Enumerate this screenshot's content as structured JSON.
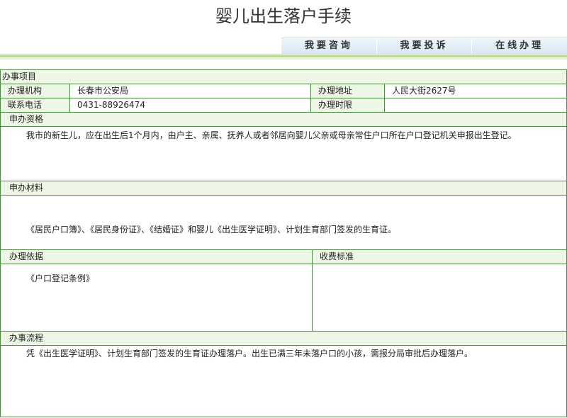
{
  "page": {
    "title": "婴儿出生落户手续"
  },
  "nav": {
    "items": [
      "我要咨询",
      "我要投诉",
      "在线办理"
    ]
  },
  "table": {
    "section_main": "办事项目",
    "agency_label": "办理机构",
    "agency_value": "长春市公安局",
    "address_label": "办理地址",
    "address_value": "人民大街2627号",
    "phone_label": "联系电话",
    "phone_value": "0431-88926474",
    "time_label": "办理时限",
    "time_value": "",
    "eligibility_title": "申办资格",
    "eligibility_text": "我市的新生儿，应在出生后1个月内，由户主、亲属、抚养人或者邻居向婴儿父亲或母亲常住户口所在户口登记机关申报出生登记。",
    "materials_title": "申办材料",
    "materials_text": "《居民户口簿》、《居民身份证》、《结婚证》和婴儿《出生医学证明》、计划生育部门签发的生育证。",
    "basis_title": "办理依据",
    "basis_text": "《户口登记条例》",
    "fee_title": "收费标准",
    "fee_text": "",
    "process_title": "办事流程",
    "process_text": "凭《出生医学证明》、计划生育部门签发的生育证办理落户。出生已满三年未落户口的小孩，需报分局审批后办理落户。"
  },
  "colors": {
    "border": "#4e8a44",
    "header_bg": "#eef6e6",
    "nav_bg": "#d7e8f3",
    "stripe": "#b9dc90"
  }
}
